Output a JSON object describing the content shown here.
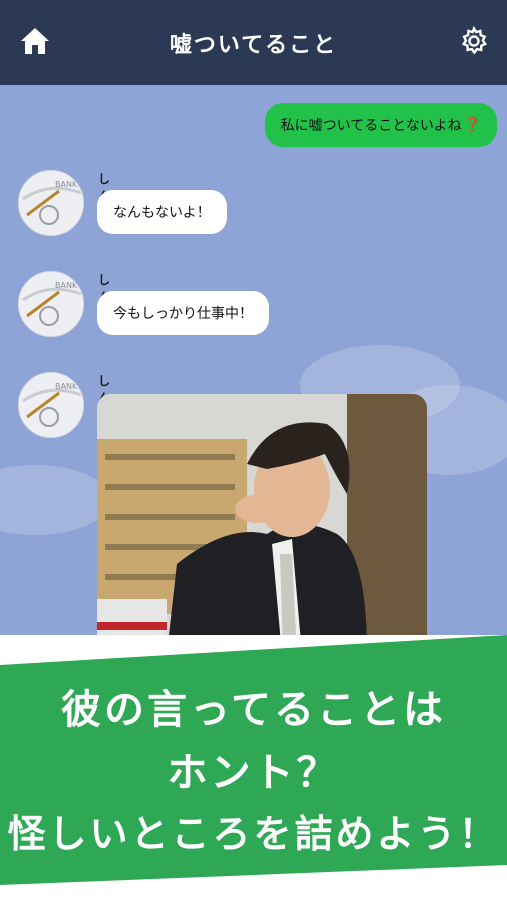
{
  "header": {
    "title": "嘘ついてること",
    "home_icon": "home-icon",
    "settings_icon": "gear-icon"
  },
  "chat": {
    "sent": {
      "text": "私に嘘ついてることないよね",
      "emoji": "❓"
    },
    "messages": [
      {
        "sender": "しんや",
        "text": "なんもないよ！"
      },
      {
        "sender": "しんや",
        "text": "今もしっかり仕事中！"
      },
      {
        "sender": "しんや",
        "type": "photo"
      }
    ],
    "avatar_label": "BANK"
  },
  "banner": {
    "line1": "彼の言ってることは",
    "line2": "ホント？",
    "line3": "怪しいところを詰めよう！"
  },
  "colors": {
    "header_bg": "#2c3955",
    "chat_bg": "#8fa4d6",
    "sent_bubble": "#22c24a",
    "banner_green": "#2fa855"
  }
}
